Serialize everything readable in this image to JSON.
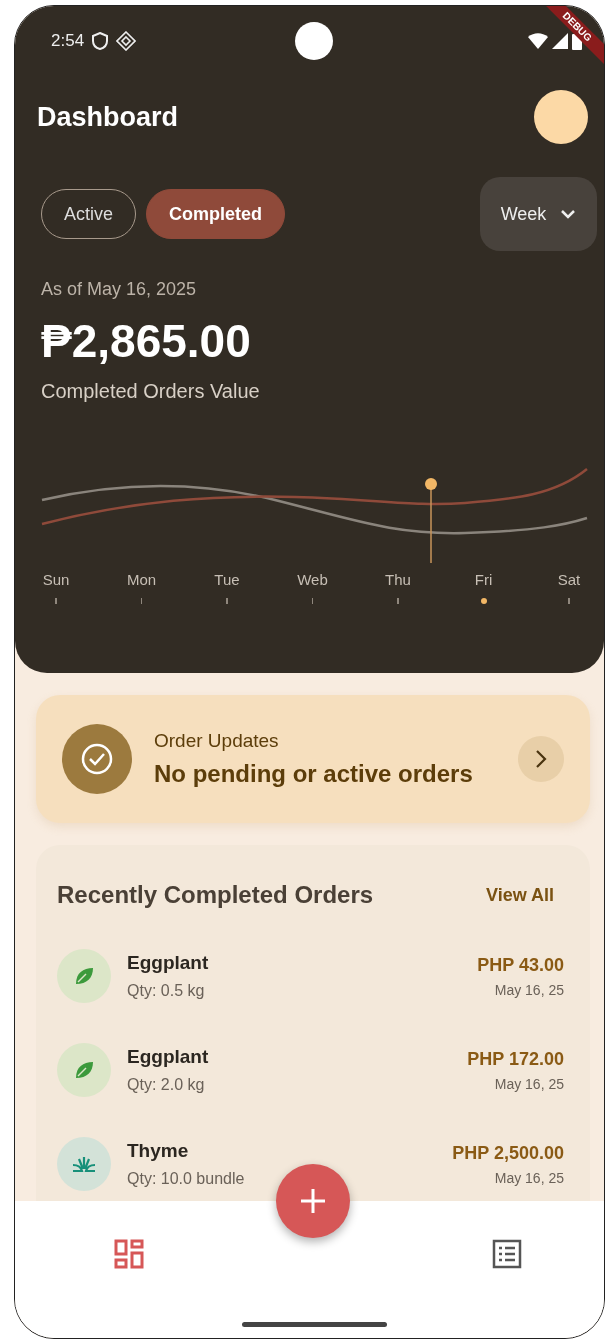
{
  "status_bar": {
    "time": "2:54",
    "debug_banner": "DEBUG"
  },
  "header": {
    "title": "Dashboard"
  },
  "filters": [
    {
      "label": "Active",
      "selected": false
    },
    {
      "label": "Completed",
      "selected": true
    }
  ],
  "period": {
    "label": "Week"
  },
  "summary": {
    "date": "As of May 16, 2025",
    "amount": "₱2,865.00",
    "caption": "Completed Orders Value"
  },
  "chart": {
    "days": [
      {
        "label": "Sun",
        "selected": false
      },
      {
        "label": "Mon",
        "selected": false
      },
      {
        "label": "Tue",
        "selected": false
      },
      {
        "label": "Web",
        "selected": false
      },
      {
        "label": "Thu",
        "selected": false
      },
      {
        "label": "Fri",
        "selected": true
      },
      {
        "label": "Sat",
        "selected": false
      }
    ]
  },
  "order_updates": {
    "title": "Order Updates",
    "message": "No pending or active orders"
  },
  "recent": {
    "title": "Recently Completed Orders",
    "action": "View All",
    "items": [
      {
        "kind": "leaf",
        "name": "Eggplant",
        "qty": "Qty: 0.5 kg",
        "price": "PHP 43.00",
        "date": "May 16, 25"
      },
      {
        "kind": "leaf",
        "name": "Eggplant",
        "qty": "Qty: 2.0 kg",
        "price": "PHP 172.00",
        "date": "May 16, 25"
      },
      {
        "kind": "sprout",
        "name": "Thyme",
        "qty": "Qty: 10.0 bundle",
        "price": "PHP 2,500.00",
        "date": "May 16, 25"
      }
    ]
  },
  "nav": [
    {
      "kind": "dashboard",
      "selected": true
    },
    {
      "kind": "list",
      "selected": false
    }
  ]
}
